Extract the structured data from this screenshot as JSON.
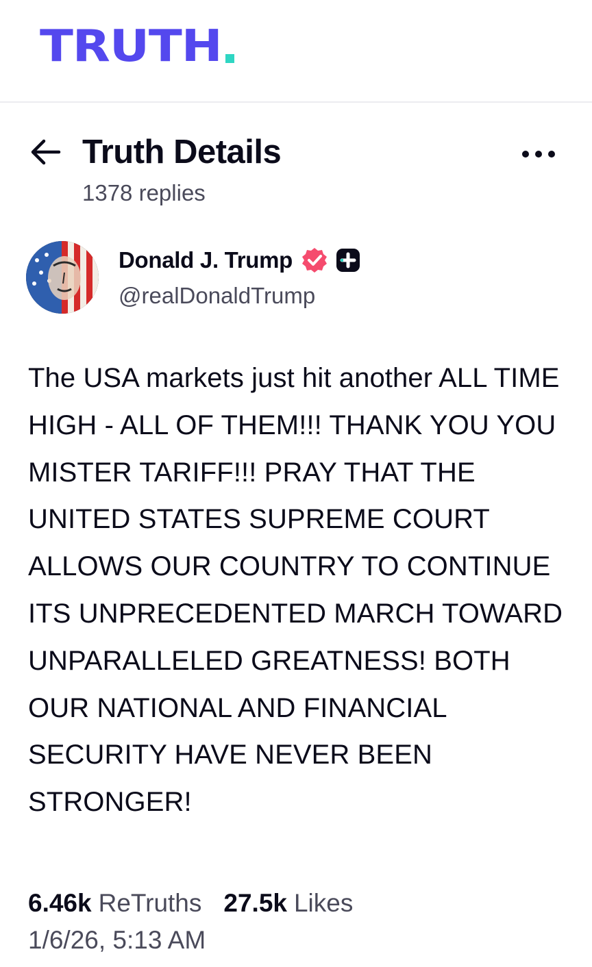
{
  "app": {
    "logo_text": "TRUTH",
    "brand_color": "#5448ee",
    "logo_dot_color": "#2fd6c3"
  },
  "header": {
    "back_icon": "arrow-left-icon",
    "title": "Truth Details",
    "replies": "1378 replies",
    "more_icon": "ellipsis-icon"
  },
  "author": {
    "name": "Donald J. Trump",
    "handle": "@realDonaldTrump",
    "verified_icon": "verified-badge-icon",
    "verified_color": "#f54b6e",
    "plus_icon": "plus-badge-icon"
  },
  "post": {
    "text": "The USA markets just hit another ALL TIME HIGH - ALL OF THEM!!! THANK YOU YOU MISTER TARIFF!!! PRAY THAT THE UNITED STATES SUPREME COURT ALLOWS OUR COUNTRY TO CONTINUE ITS UNPRECEDENTED MARCH TOWARD UNPARALLELED GREATNESS! BOTH OUR NATIONAL AND FINANCIAL SECURITY HAVE NEVER BEEN STRONGER!",
    "retruths_count": "6.46k",
    "retruths_label": "ReTruths",
    "likes_count": "27.5k",
    "likes_label": "Likes",
    "timestamp": "1/6/26, 5:13 AM"
  }
}
